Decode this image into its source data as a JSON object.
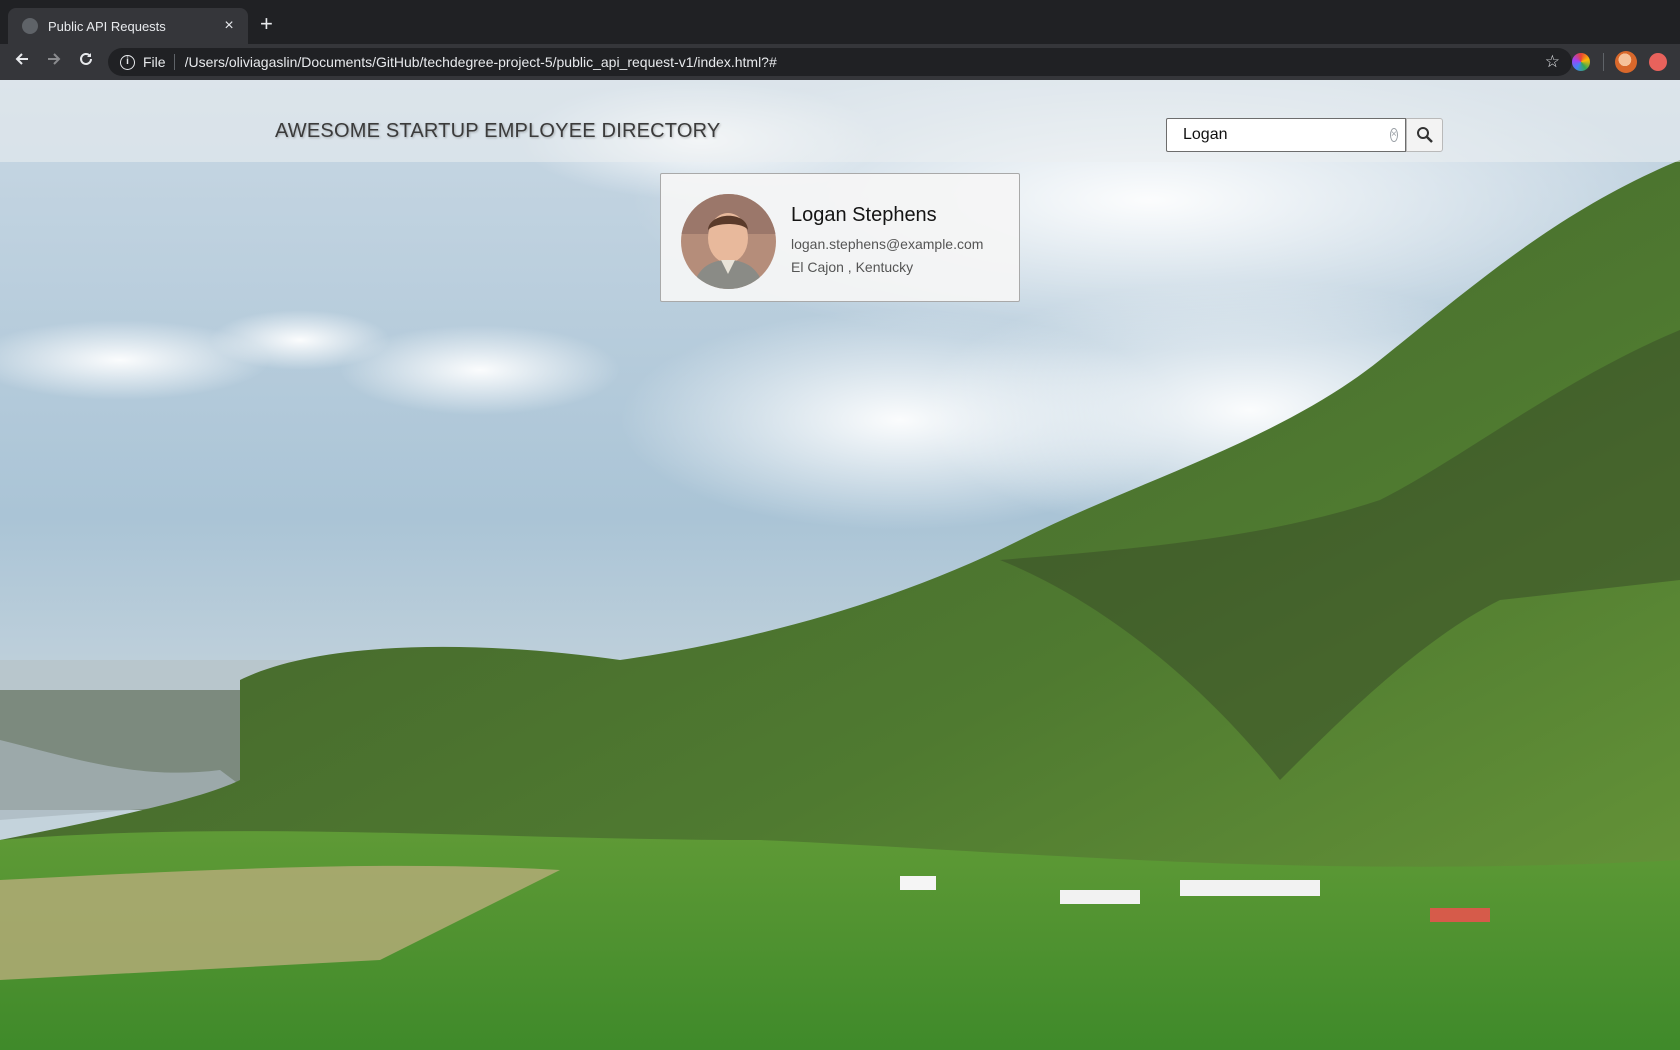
{
  "browser": {
    "tab": {
      "title": "Public API Requests",
      "close_label": "×"
    },
    "new_tab_label": "+",
    "address_bar": {
      "scheme_label": "File",
      "url": "/Users/oliviagaslin/Documents/GitHub/techdegree-project-5/public_api_request-v1/index.html?#"
    }
  },
  "page": {
    "header": {
      "title": "AWESOME STARTUP EMPLOYEE DIRECTORY"
    },
    "search": {
      "value": "Logan"
    },
    "employees": [
      {
        "name": "Logan Stephens",
        "email": "logan.stephens@example.com",
        "location": "El Cajon , Kentucky"
      }
    ]
  },
  "colors": {
    "chrome_dark": "#202124",
    "chrome_toolbar": "#35363a",
    "header_overlay": "#ebeef0",
    "card_background": "#f5f5f5"
  },
  "icons": [
    "globe-favicon-icon",
    "close-icon",
    "plus-icon",
    "back-arrow-icon",
    "forward-arrow-icon",
    "reload-icon",
    "info-icon",
    "star-icon",
    "extension-icon",
    "profile-avatar-icon",
    "clear-icon",
    "search-icon"
  ]
}
